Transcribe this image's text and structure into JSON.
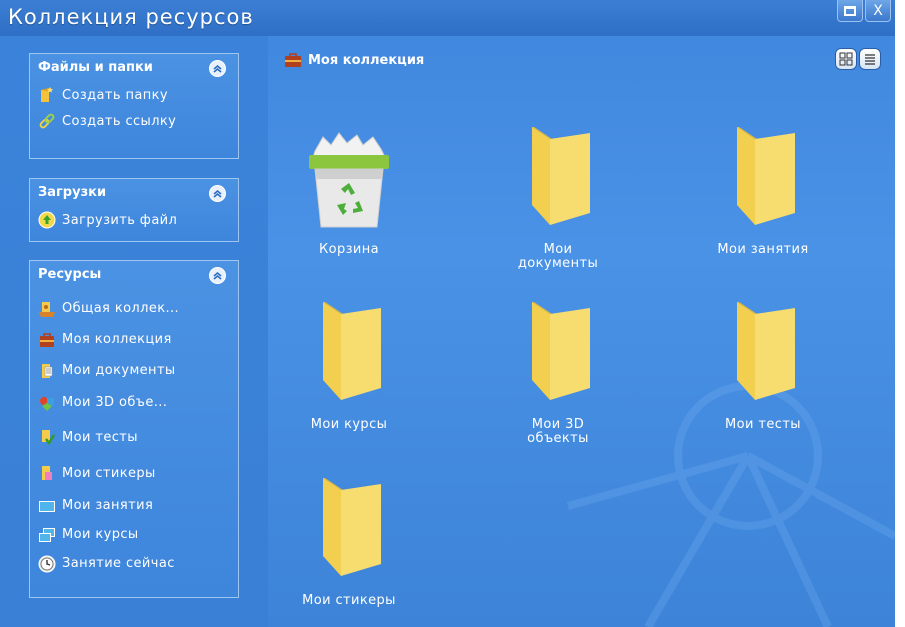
{
  "window": {
    "title": "Коллекция ресурсов",
    "controls": [
      "restore",
      "close"
    ],
    "close_label": "X"
  },
  "sidebar": {
    "panels": [
      {
        "title": "Файлы и папки",
        "items": [
          {
            "label": "Создать папку",
            "icon": "new-folder-icon"
          },
          {
            "label": "Создать ссылку",
            "icon": "link-icon"
          }
        ]
      },
      {
        "title": "Загрузки",
        "items": [
          {
            "label": "Загрузить файл",
            "icon": "upload-icon"
          }
        ]
      },
      {
        "title": "Ресурсы",
        "items": [
          {
            "label": "Общая коллек...",
            "icon": "shared-collection-icon"
          },
          {
            "label": "Моя коллекция",
            "icon": "briefcase-icon"
          },
          {
            "label": "Мои документы",
            "icon": "documents-icon"
          },
          {
            "label": "Мои 3D объе...",
            "icon": "3d-objects-icon"
          },
          {
            "label": "Мои тесты",
            "icon": "tests-icon"
          },
          {
            "label": "Мои стикеры",
            "icon": "stickers-icon"
          },
          {
            "label": "Мои занятия",
            "icon": "lessons-icon"
          },
          {
            "label": "Мои курсы",
            "icon": "courses-icon"
          },
          {
            "label": "Занятие сейчас",
            "icon": "clock-icon"
          }
        ]
      }
    ]
  },
  "main": {
    "breadcrumb": "Моя коллекция",
    "view_modes": [
      "grid-view",
      "list-view"
    ],
    "tiles": [
      {
        "label_lines": [
          "Корзина"
        ],
        "kind": "recycle-bin"
      },
      {
        "label_lines": [
          "Мои",
          "документы"
        ],
        "kind": "folder"
      },
      {
        "label_lines": [
          "Мои занятия"
        ],
        "kind": "folder"
      },
      {
        "label_lines": [
          "Мои курсы"
        ],
        "kind": "folder"
      },
      {
        "label_lines": [
          "Мои 3D",
          "объекты"
        ],
        "kind": "folder"
      },
      {
        "label_lines": [
          "Мои тесты"
        ],
        "kind": "folder"
      },
      {
        "label_lines": [
          "Мои стикеры"
        ],
        "kind": "folder"
      }
    ]
  },
  "colors": {
    "background": "#3f86de",
    "panel_border": "#9ec6f2",
    "folder": "#f7dc6f"
  }
}
